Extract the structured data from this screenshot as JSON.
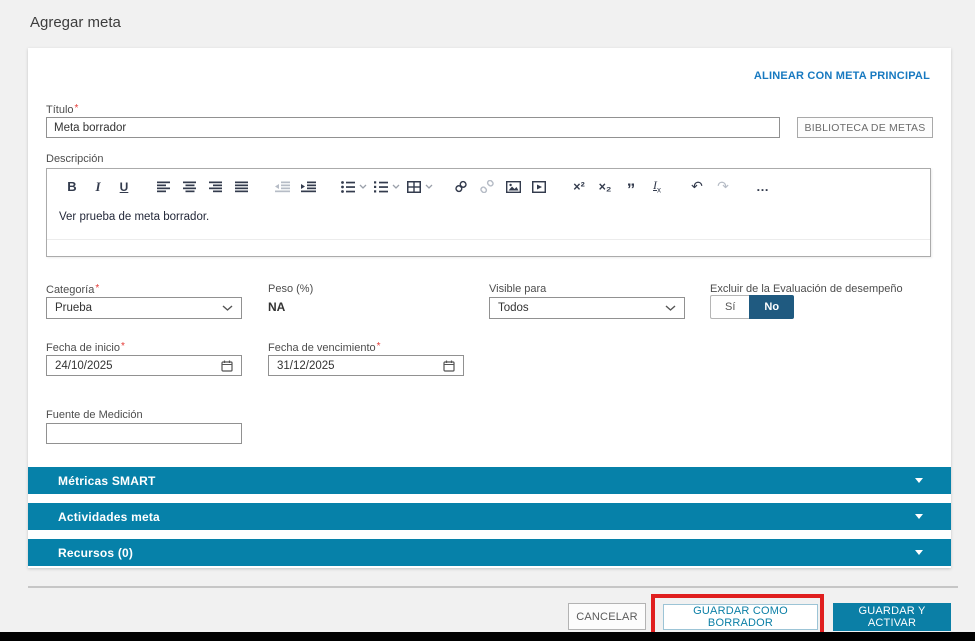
{
  "header": {
    "title": "Agregar meta"
  },
  "card": {
    "align_link": "ALINEAR CON META PRINCIPAL",
    "titulo": {
      "label": "Título",
      "required": true,
      "value": "Meta borrador"
    },
    "library_button": "BIBLIOTECA DE METAS",
    "descripcion": {
      "label": "Descripción",
      "content": "Ver prueba de meta borrador.",
      "toolbar": [
        {
          "name": "bold"
        },
        {
          "name": "italic"
        },
        {
          "name": "underline"
        },
        {
          "name": "align-left",
          "group": true
        },
        {
          "name": "align-center"
        },
        {
          "name": "align-right"
        },
        {
          "name": "align-justify"
        },
        {
          "name": "outdent",
          "group": true,
          "muted": true
        },
        {
          "name": "indent"
        },
        {
          "name": "bullet-list",
          "group": true,
          "caret": true
        },
        {
          "name": "numbered-list",
          "caret": true
        },
        {
          "name": "table",
          "caret": true
        },
        {
          "name": "link",
          "group": true
        },
        {
          "name": "unlink",
          "muted": true
        },
        {
          "name": "image"
        },
        {
          "name": "video"
        },
        {
          "name": "superscript",
          "group": true
        },
        {
          "name": "subscript"
        },
        {
          "name": "blockquote"
        },
        {
          "name": "clear-formatting"
        },
        {
          "name": "undo",
          "group": true
        },
        {
          "name": "redo",
          "muted": true
        },
        {
          "name": "more",
          "group": true
        }
      ]
    },
    "categoria": {
      "label": "Categoría",
      "required": true,
      "value": "Prueba"
    },
    "peso": {
      "label": "Peso (%)",
      "value": "NA"
    },
    "visible_para": {
      "label": "Visible para",
      "value": "Todos"
    },
    "excluir": {
      "label": "Excluir de la Evaluación de desempeño",
      "option_yes": "Sí",
      "option_no": "No",
      "selected": "No"
    },
    "fecha_inicio": {
      "label": "Fecha de inicio",
      "required": true,
      "value": "24/10/2025"
    },
    "fecha_vencimiento": {
      "label": "Fecha de vencimiento",
      "required": true,
      "value": "31/12/2025"
    },
    "fuente_medicion": {
      "label": "Fuente de Medición",
      "value": ""
    },
    "sections": [
      {
        "label": "Métricas SMART"
      },
      {
        "label": "Actividades meta"
      },
      {
        "label": "Recursos (0)"
      }
    ]
  },
  "footer": {
    "cancel": "CANCELAR",
    "save_draft": "GUARDAR COMO BORRADOR",
    "save_activate": "GUARDAR Y ACTIVAR"
  },
  "colors": {
    "accent_teal": "#0681a9",
    "button_teal": "#0b7fa6",
    "toggle_navy": "#1f5a80",
    "link_blue": "#1779c0",
    "annotation_red": "#e01f1f",
    "page_background": "#f1f1f1"
  }
}
